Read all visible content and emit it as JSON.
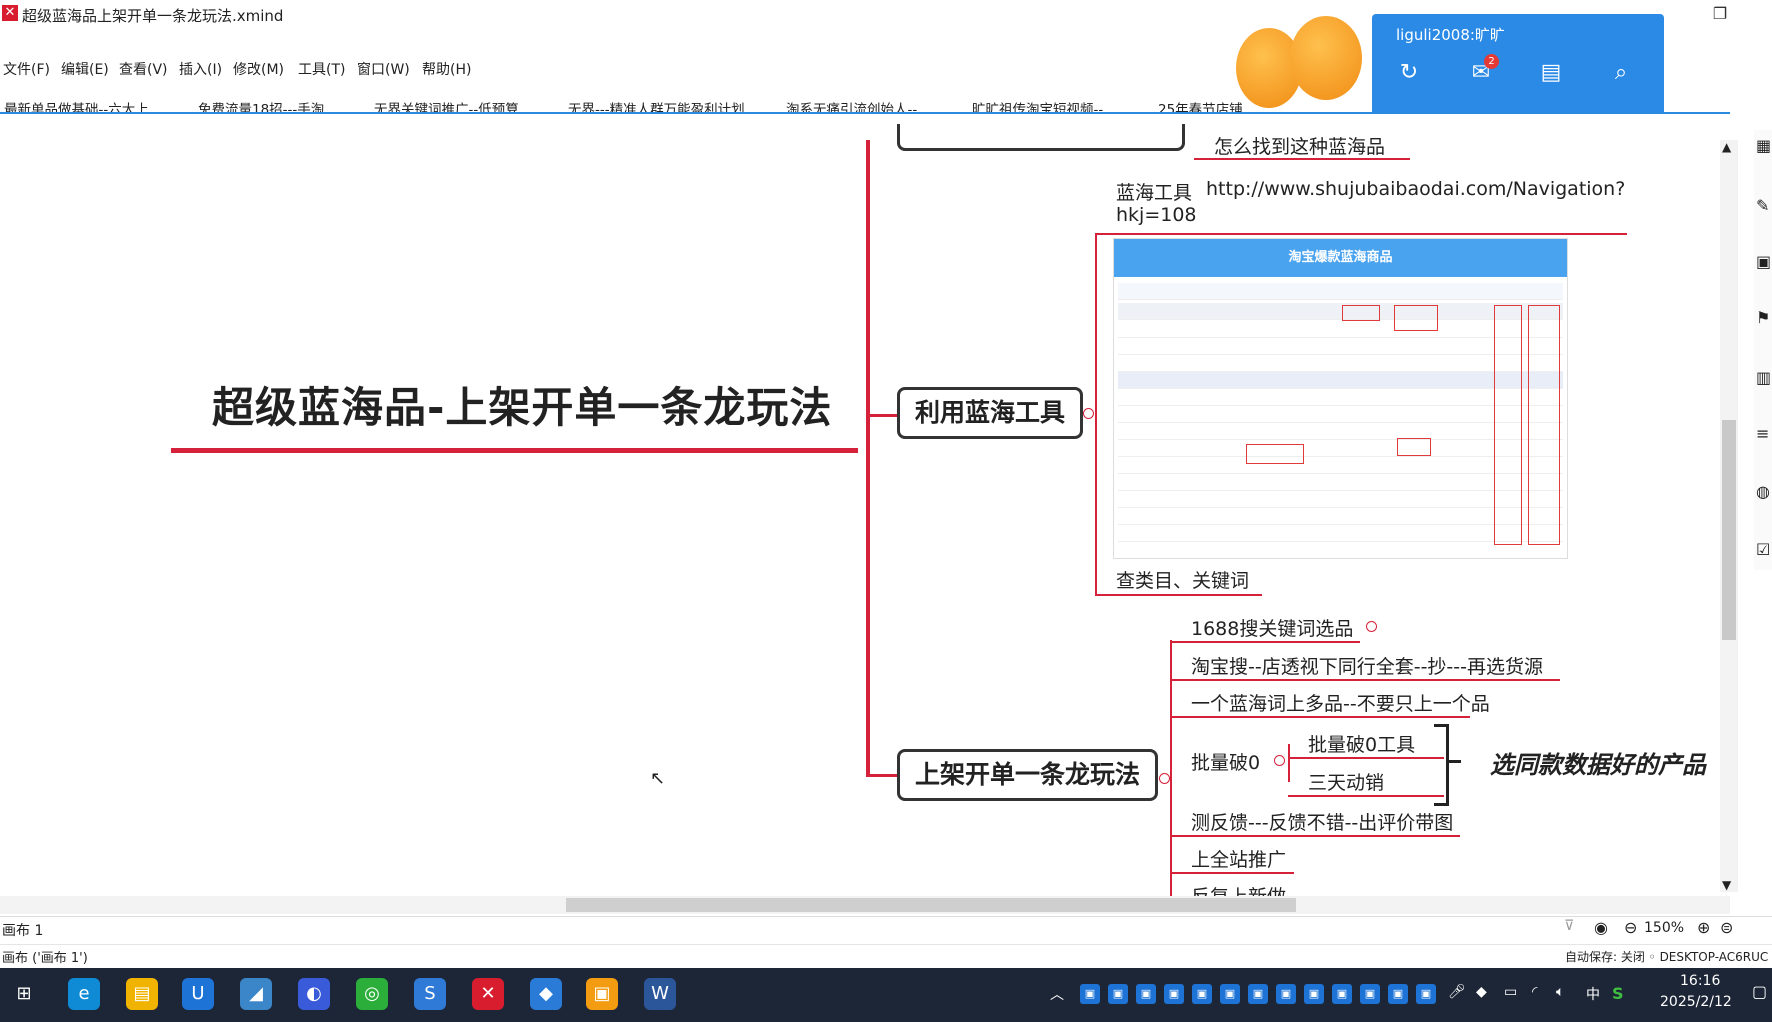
{
  "window": {
    "title": "超级蓝海品上架开单一条龙玩法.xmind",
    "app_icon": "xmind-icon",
    "restore_label": "❐",
    "close_label": "✕"
  },
  "menu": [
    "文件(F)",
    "编辑(E)",
    "查看(V)",
    "插入(I)",
    "修改(M)",
    "工具(T)",
    "窗口(W)",
    "帮助(H)"
  ],
  "toolbar": {
    "icons": [
      "home-icon",
      "save-icon",
      "undo-icon",
      "redo-icon",
      "structure-icon",
      "dropdown-icon",
      "relationship-icon",
      "boundary-icon",
      "summary-icon",
      "more-icon",
      "dropdown-icon"
    ]
  },
  "bookmarks": [
    "最新单品做基础--六大上...",
    "免费流量18招---手淘...",
    "无界关键词推广--低预算...",
    "无界---精准人群万能盈利计划",
    "淘系无痛引流创始人--...",
    "旷旷祖传淘宝短视频--...",
    "25年春节店铺"
  ],
  "qq": {
    "user": "liguli2008:旷旷",
    "badge": "2"
  },
  "mindmap": {
    "central": "超级蓝海品-上架开单一条龙玩法",
    "top_partial": "怎么找到这种蓝海品",
    "topic1": "利用蓝海工具",
    "tool_label": "蓝海工具",
    "tool_url_line1": "http://www.shujubaibaodai.com/Navigation?",
    "tool_url_line2": "hkj=108",
    "shot_header": "淘宝爆款蓝海商品",
    "shot_caption": "查类目、关键词",
    "topic2": "上架开单一条龙玩法",
    "items": [
      "1688搜关键词选品",
      "淘宝搜--店透视下同行全套--抄---再选货源",
      "一个蓝海词上多品--不要只上一个品",
      "批量破0",
      "测反馈---反馈不错--出评价带图",
      "上全站推广",
      "反复上新做"
    ],
    "sub_items": [
      "批量破0工具",
      "三天动销"
    ],
    "summary": "选同款数据好的产品"
  },
  "sheet": {
    "tab": "画布 1",
    "zoom": "150%"
  },
  "status": {
    "left": "画布 ('画布 1')",
    "right": "自动保存: 关闭  ◦ DESKTOP-AC6RUC"
  },
  "taskbar": {
    "time": "16:16",
    "date": "2025/2/12",
    "apps": [
      "windows-start-icon",
      "edge-icon",
      "file-explorer-icon",
      "shield-app-icon",
      "notes-app-icon",
      "feishu-icon",
      "wechat-icon",
      "browser-icon",
      "xmind-icon",
      "fox-app-icon",
      "orange-app-icon",
      "word-icon"
    ],
    "app_colors": [
      "#1d2637",
      "#0f8bd6",
      "#f0b400",
      "#1e73d6",
      "#3a86c8",
      "#3a5bd9",
      "#2bae3a",
      "#2e7ad6",
      "#d81e2e",
      "#2a7bd8",
      "#f39c12",
      "#2b579a"
    ],
    "ime": "中"
  }
}
